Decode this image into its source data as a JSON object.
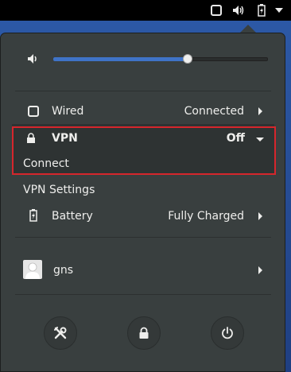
{
  "top_bar": {
    "icons": [
      "screen-icon",
      "volume-icon",
      "battery-icon",
      "menu-arrow-icon"
    ]
  },
  "volume": {
    "icon": "speaker-icon",
    "level_percent": 63
  },
  "wired": {
    "icon": "network-wired-icon",
    "label": "Wired",
    "status": "Connected"
  },
  "vpn": {
    "icon": "vpn-lock-icon",
    "label": "VPN",
    "status": "Off",
    "connect_label": "Connect",
    "settings_label": "VPN Settings"
  },
  "battery": {
    "icon": "battery-charging-icon",
    "label": "Battery",
    "status": "Fully Charged"
  },
  "user": {
    "icon": "avatar-icon",
    "name": "gns"
  },
  "actions": [
    {
      "name": "settings",
      "icon": "tools-icon"
    },
    {
      "name": "lock",
      "icon": "lock-icon"
    },
    {
      "name": "power",
      "icon": "power-icon"
    }
  ]
}
